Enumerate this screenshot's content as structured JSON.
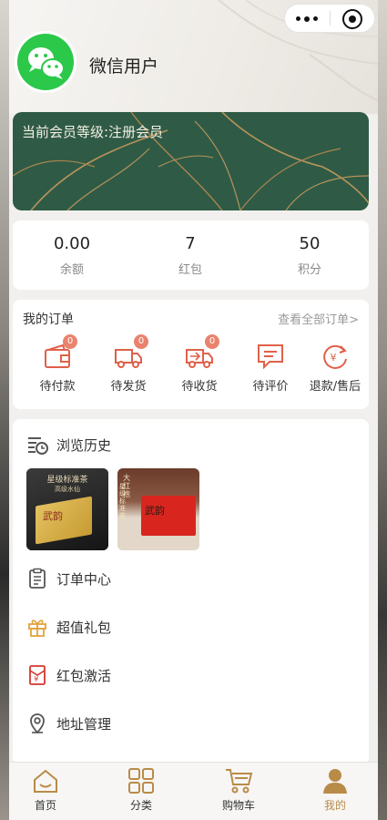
{
  "header": {
    "username": "微信用户"
  },
  "member": {
    "level_text": "当前会员等级:注册会员"
  },
  "stats": [
    {
      "value": "0.00",
      "label": "余额"
    },
    {
      "value": "7",
      "label": "红包"
    },
    {
      "value": "50",
      "label": "积分"
    }
  ],
  "orders": {
    "title": "我的订单",
    "view_all": "查看全部订单>",
    "items": [
      {
        "label": "待付款",
        "badge": "0",
        "icon": "wallet-icon"
      },
      {
        "label": "待发货",
        "badge": "0",
        "icon": "truck-icon"
      },
      {
        "label": "待收货",
        "badge": "0",
        "icon": "truck-receive-icon"
      },
      {
        "label": "待评价",
        "icon": "comment-icon"
      },
      {
        "label": "退款/售后",
        "icon": "refund-icon"
      }
    ]
  },
  "menu": {
    "history_label": "浏览历史",
    "history_items": [
      {
        "title": "星级标准茶",
        "subtitle": "高级水仙",
        "logo": "武韵"
      },
      {
        "title": "大红袍",
        "subtitle": "星级标准茶",
        "logo": "武韵"
      }
    ],
    "items": [
      {
        "label": "订单中心",
        "icon": "clipboard-icon"
      },
      {
        "label": "超值礼包",
        "icon": "gift-icon"
      },
      {
        "label": "红包激活",
        "icon": "red-packet-icon"
      },
      {
        "label": "地址管理",
        "icon": "location-icon"
      }
    ]
  },
  "tabbar": [
    {
      "label": "首页",
      "icon": "home-icon"
    },
    {
      "label": "分类",
      "icon": "grid-icon"
    },
    {
      "label": "购物车",
      "icon": "cart-icon"
    },
    {
      "label": "我的",
      "icon": "user-icon",
      "active": true
    }
  ],
  "colors": {
    "accent": "#b98b48",
    "badge": "#e9836e",
    "card_green": "#2f5b46",
    "order_icon": "#e0604a"
  }
}
